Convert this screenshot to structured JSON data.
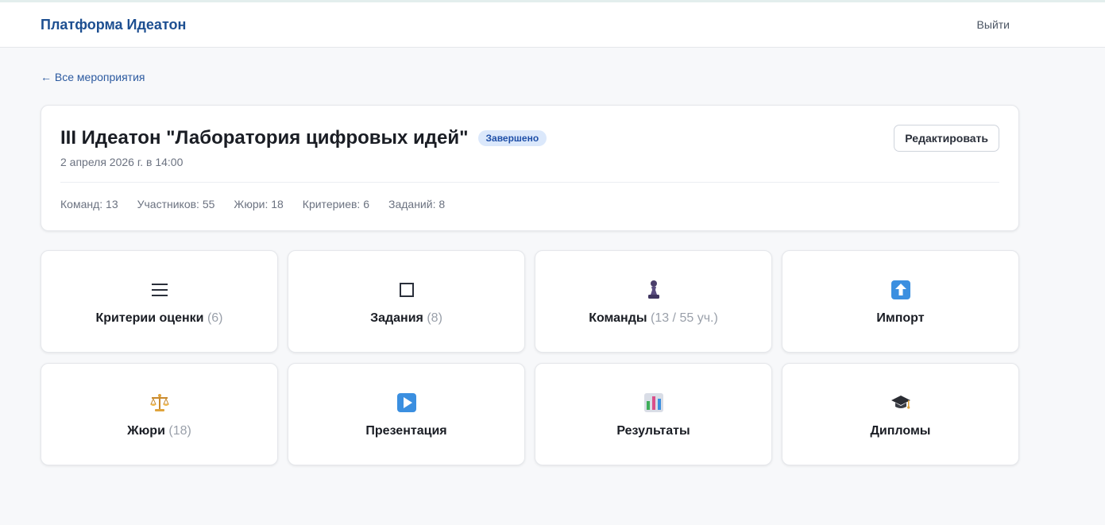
{
  "header": {
    "brand": "Платформа Идеатон",
    "logout": "Выйти"
  },
  "nav": {
    "back": "← Все мероприятия"
  },
  "event": {
    "title": "III Идеатон \"Лаборатория цифровых идей\"",
    "status": "Завершено",
    "date": "2 апреля 2026 г. в 14:00",
    "edit_label": "Редактировать",
    "stats": [
      "Команд: 13",
      "Участников: 55",
      "Жюри: 18",
      "Критериев: 6",
      "Заданий: 8"
    ]
  },
  "tiles": [
    {
      "icon": "list-icon",
      "label": "Критерии оценки",
      "count": "(6)"
    },
    {
      "icon": "square-icon",
      "label": "Задания",
      "count": "(8)"
    },
    {
      "icon": "chess-pawn-icon",
      "label": "Команды",
      "count": "(13 / 55 уч.)"
    },
    {
      "icon": "upload-arrow-icon",
      "label": "Импорт",
      "count": ""
    },
    {
      "icon": "scales-icon",
      "label": "Жюри",
      "count": "(18)"
    },
    {
      "icon": "play-icon",
      "label": "Презентация",
      "count": ""
    },
    {
      "icon": "bar-chart-icon",
      "label": "Результаты",
      "count": ""
    },
    {
      "icon": "graduation-cap-icon",
      "label": "Дипломы",
      "count": ""
    }
  ]
}
